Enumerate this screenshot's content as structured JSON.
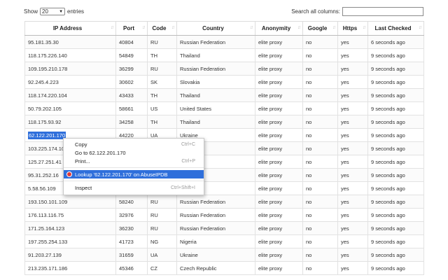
{
  "controls": {
    "show_label": "Show",
    "page_size": "20",
    "entries_label": "entries",
    "search_label": "Search all columns:",
    "search_value": ""
  },
  "columns": [
    "IP Address",
    "Port",
    "Code",
    "Country",
    "Anonymity",
    "Google",
    "Https",
    "Last Checked"
  ],
  "rows": [
    [
      "95.181.35.30",
      "40804",
      "RU",
      "Russian Federation",
      "elite proxy",
      "no",
      "yes",
      "6 seconds ago"
    ],
    [
      "118.175.226.140",
      "54849",
      "TH",
      "Thailand",
      "elite proxy",
      "no",
      "yes",
      "9 seconds ago"
    ],
    [
      "109.195.210.178",
      "36299",
      "RU",
      "Russian Federation",
      "elite proxy",
      "no",
      "yes",
      "9 seconds ago"
    ],
    [
      "92.245.4.223",
      "30602",
      "SK",
      "Slovakia",
      "elite proxy",
      "no",
      "yes",
      "9 seconds ago"
    ],
    [
      "118.174.220.104",
      "43433",
      "TH",
      "Thailand",
      "elite proxy",
      "no",
      "yes",
      "9 seconds ago"
    ],
    [
      "50.79.202.105",
      "58661",
      "US",
      "United States",
      "elite proxy",
      "no",
      "yes",
      "9 seconds ago"
    ],
    [
      "118.175.93.92",
      "34258",
      "TH",
      "Thailand",
      "elite proxy",
      "no",
      "yes",
      "9 seconds ago"
    ],
    [
      "62.122.201.170",
      "44220",
      "UA",
      "Ukraine",
      "elite proxy",
      "no",
      "yes",
      "9 seconds ago"
    ],
    [
      "103.225.174.10",
      "",
      "",
      "",
      "elite proxy",
      "no",
      "yes",
      "9 seconds ago"
    ],
    [
      "125.27.251.41",
      "",
      "",
      "",
      "elite proxy",
      "no",
      "yes",
      "9 seconds ago"
    ],
    [
      "95.31.252.16",
      "",
      "",
      "eration",
      "elite proxy",
      "no",
      "yes",
      "9 seconds ago"
    ],
    [
      "5.58.56.109",
      "",
      "",
      "",
      "elite proxy",
      "no",
      "yes",
      "9 seconds ago"
    ],
    [
      "193.150.101.109",
      "58240",
      "RU",
      "Russian Federation",
      "elite proxy",
      "no",
      "yes",
      "9 seconds ago"
    ],
    [
      "176.113.116.75",
      "32976",
      "RU",
      "Russian Federation",
      "elite proxy",
      "no",
      "yes",
      "9 seconds ago"
    ],
    [
      "171.25.164.123",
      "36230",
      "RU",
      "Russian Federation",
      "elite proxy",
      "no",
      "yes",
      "9 seconds ago"
    ],
    [
      "197.255.254.133",
      "41723",
      "NG",
      "Nigeria",
      "elite proxy",
      "no",
      "yes",
      "9 seconds ago"
    ],
    [
      "91.203.27.139",
      "31659",
      "UA",
      "Ukraine",
      "elite proxy",
      "no",
      "yes",
      "9 seconds ago"
    ],
    [
      "213.235.171.186",
      "45346",
      "CZ",
      "Czech Republic",
      "elite proxy",
      "no",
      "yes",
      "9 seconds ago"
    ]
  ],
  "context_menu": {
    "items": [
      {
        "label": "Copy",
        "shortcut": "Ctrl+C"
      },
      {
        "label": "Go to 62.122.201.170",
        "shortcut": ""
      },
      {
        "label": "Print...",
        "shortcut": "Ctrl+P"
      },
      {
        "label": "Lookup '62.122.201.170' on AbuseIPDB",
        "shortcut": "",
        "icon": "abuseipdb-icon"
      },
      {
        "label": "Inspect",
        "shortcut": "Ctrl+Shift+I"
      }
    ]
  },
  "colors": {
    "selection": "#2f6fdb",
    "abuse_icon": "#e03a3a"
  }
}
